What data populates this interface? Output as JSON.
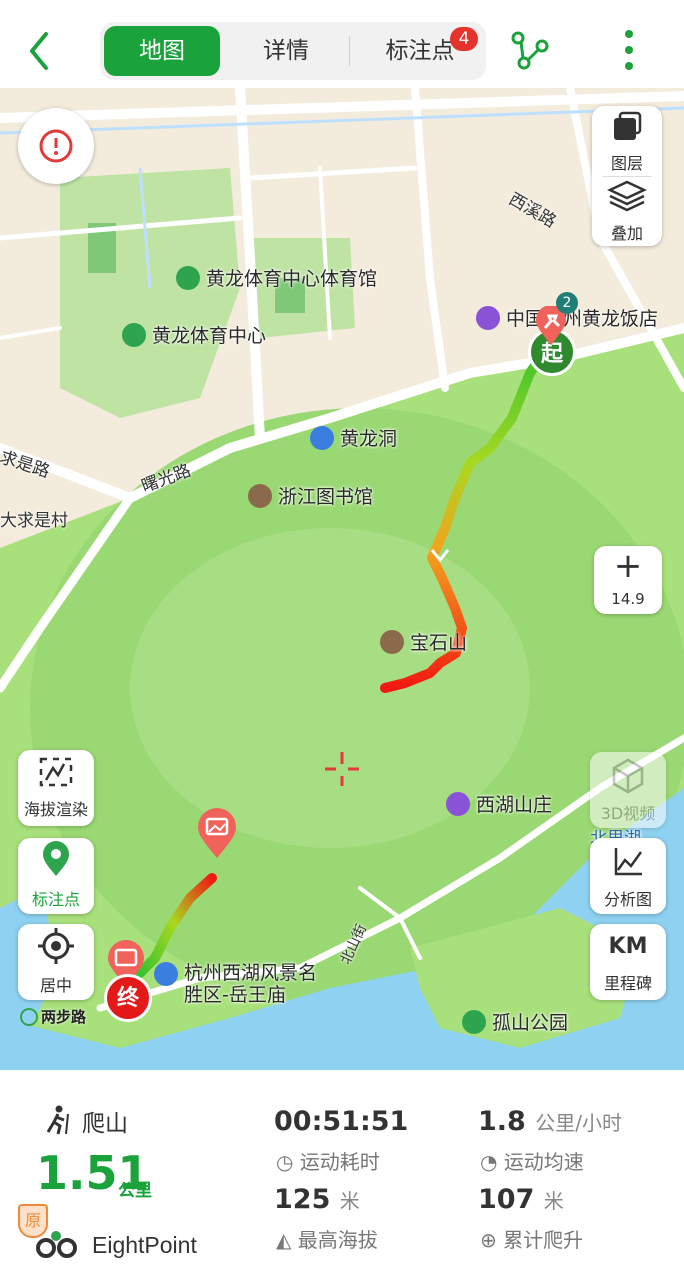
{
  "header": {
    "tabs": [
      {
        "label": "地图",
        "active": true
      },
      {
        "label": "详情",
        "active": false
      },
      {
        "label": "标注点",
        "active": false,
        "badge": "4"
      }
    ],
    "icons": [
      "back-arrow-icon",
      "route-share-icon",
      "more-vertical-icon"
    ],
    "accent": "#1aa33a"
  },
  "map": {
    "pois": {
      "sports_hall": "黄龙体育中心体育馆",
      "sports_center": "黄龙体育中心",
      "hotel": "中国…州黄龙饭店",
      "huanglong_cave": "黄龙洞",
      "library": "浙江图书馆",
      "baoshi_mountain": "宝石山",
      "xihu_villa": "西湖山庄",
      "scenic_area": "杭州西湖风景名胜区-岳王庙",
      "gushan_park": "孤山公园"
    },
    "roads": {
      "xixi": "西溪路",
      "shuguang": "曙光路",
      "qiushi": "求是路",
      "qiushi_village": "大求是村",
      "beishan": "北山街",
      "beili": "北里湖"
    },
    "start_label": "起",
    "start_badge": "2",
    "end_label": "终",
    "brand": "两步路",
    "zoom": "14.9",
    "controls": {
      "layers": "图层",
      "overlay": "叠加",
      "zoom_in": "+",
      "elevation": "海拔渲染",
      "markers": "标注点",
      "center": "居中",
      "video3d": "3D视频",
      "analysis": "分析图",
      "milestone_top": "KM",
      "milestone": "里程碑"
    }
  },
  "stats": {
    "activity": "爬山",
    "distance": "1.51",
    "distance_unit": "公里",
    "duration": "00:51:51",
    "duration_label": "运动耗时",
    "speed": "1.8",
    "speed_unit": "公里/小时",
    "speed_label": "运动均速",
    "max_alt": "125",
    "max_alt_unit": "米",
    "max_alt_label": "最高海拔",
    "climb": "107",
    "climb_unit": "米",
    "climb_label": "累计爬升",
    "original_badge": "原",
    "author": "EightPoint"
  }
}
